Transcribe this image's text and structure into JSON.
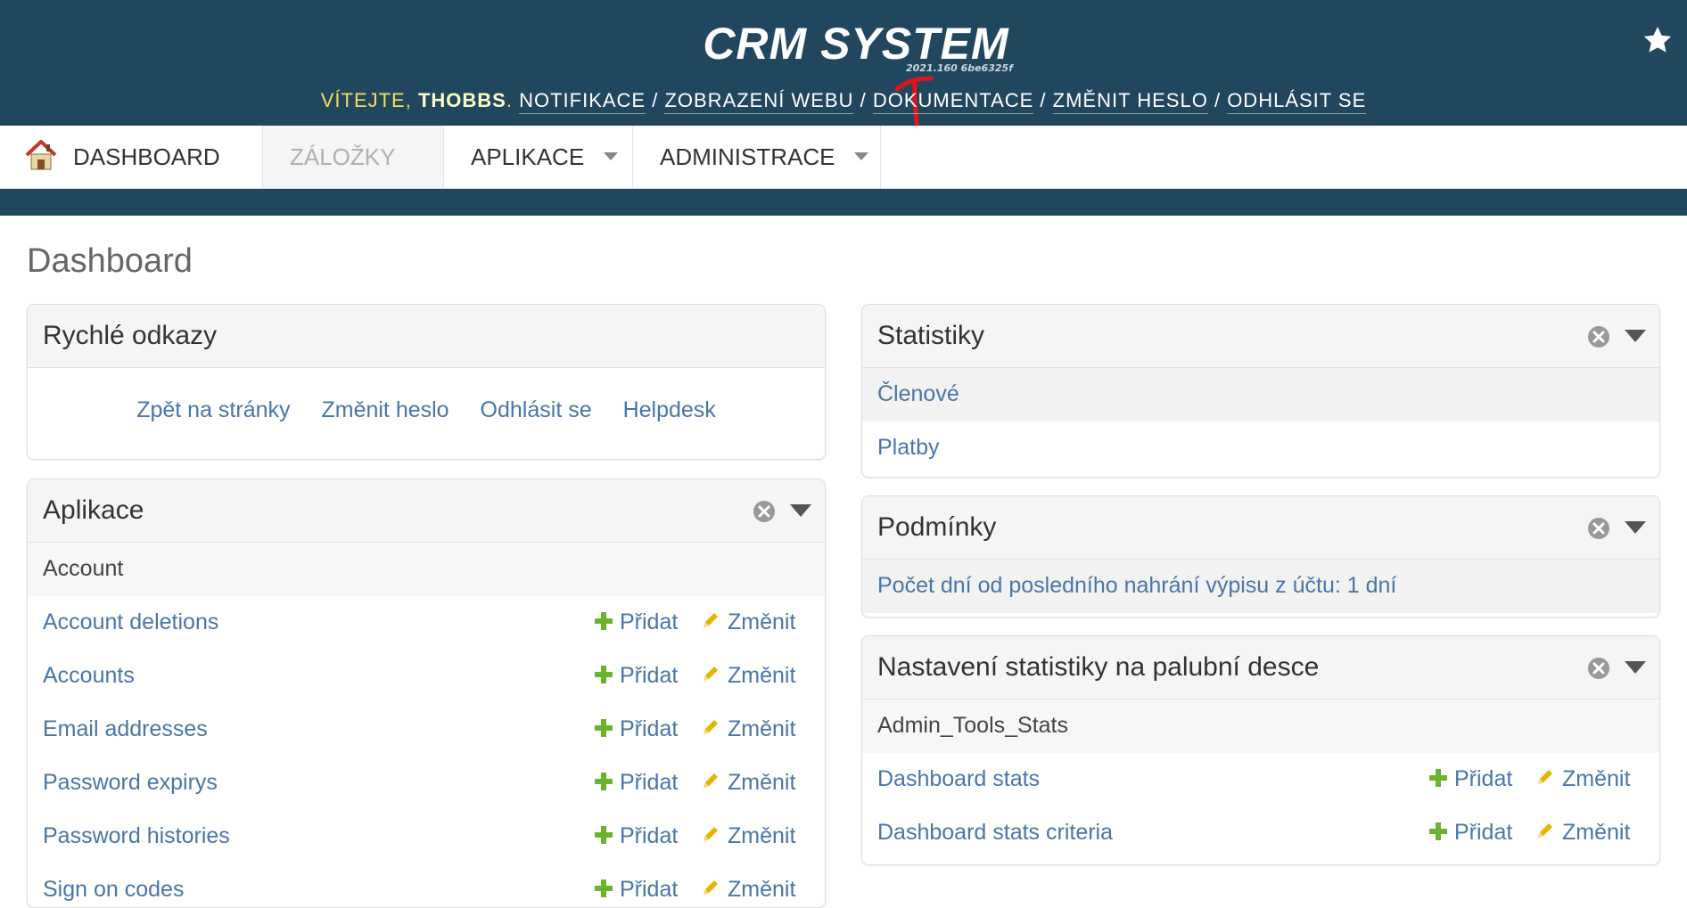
{
  "header": {
    "brand": "CRM SYSTEM",
    "version": "2021.160 6be6325f",
    "welcome_prefix": "VÍTEJTE, ",
    "username": "THOBBS",
    "welcome_suffix": ". ",
    "links": [
      "NOTIFIKACE",
      "ZOBRAZENÍ WEBU",
      "DOKUMENTACE",
      "ZMĚNIT HESLO",
      "ODHLÁSIT SE"
    ],
    "separator": " / "
  },
  "nav": {
    "dashboard": "DASHBOARD",
    "bookmarks": "ZÁLOŽKY",
    "apps": "APLIKACE",
    "admin": "ADMINISTRACE"
  },
  "page_title": "Dashboard",
  "quick_links": {
    "title": "Rychlé odkazy",
    "links": [
      "Zpět na stránky",
      "Změnit heslo",
      "Odhlásit se",
      "Helpdesk"
    ]
  },
  "apps": {
    "title": "Aplikace",
    "group": "Account",
    "add_label": "Přidat",
    "change_label": "Změnit",
    "rows": [
      "Account deletions",
      "Accounts",
      "Email addresses",
      "Password expirys",
      "Password histories",
      "Sign on codes"
    ]
  },
  "stats": {
    "title": "Statistiky",
    "items": [
      "Členové",
      "Platby"
    ]
  },
  "conditions": {
    "title": "Podmínky",
    "text": "Počet dní od posledního nahrání výpisu z účtu: 1 dní"
  },
  "dashboard_settings": {
    "title": "Nastavení statistiky na palubní desce",
    "group": "Admin_Tools_Stats",
    "rows": [
      "Dashboard stats",
      "Dashboard stats criteria"
    ]
  },
  "colors": {
    "header_bg": "#21475f",
    "link": "#4a75a8",
    "add_green": "#6ab42d",
    "change_yellow": "#e8b400"
  }
}
